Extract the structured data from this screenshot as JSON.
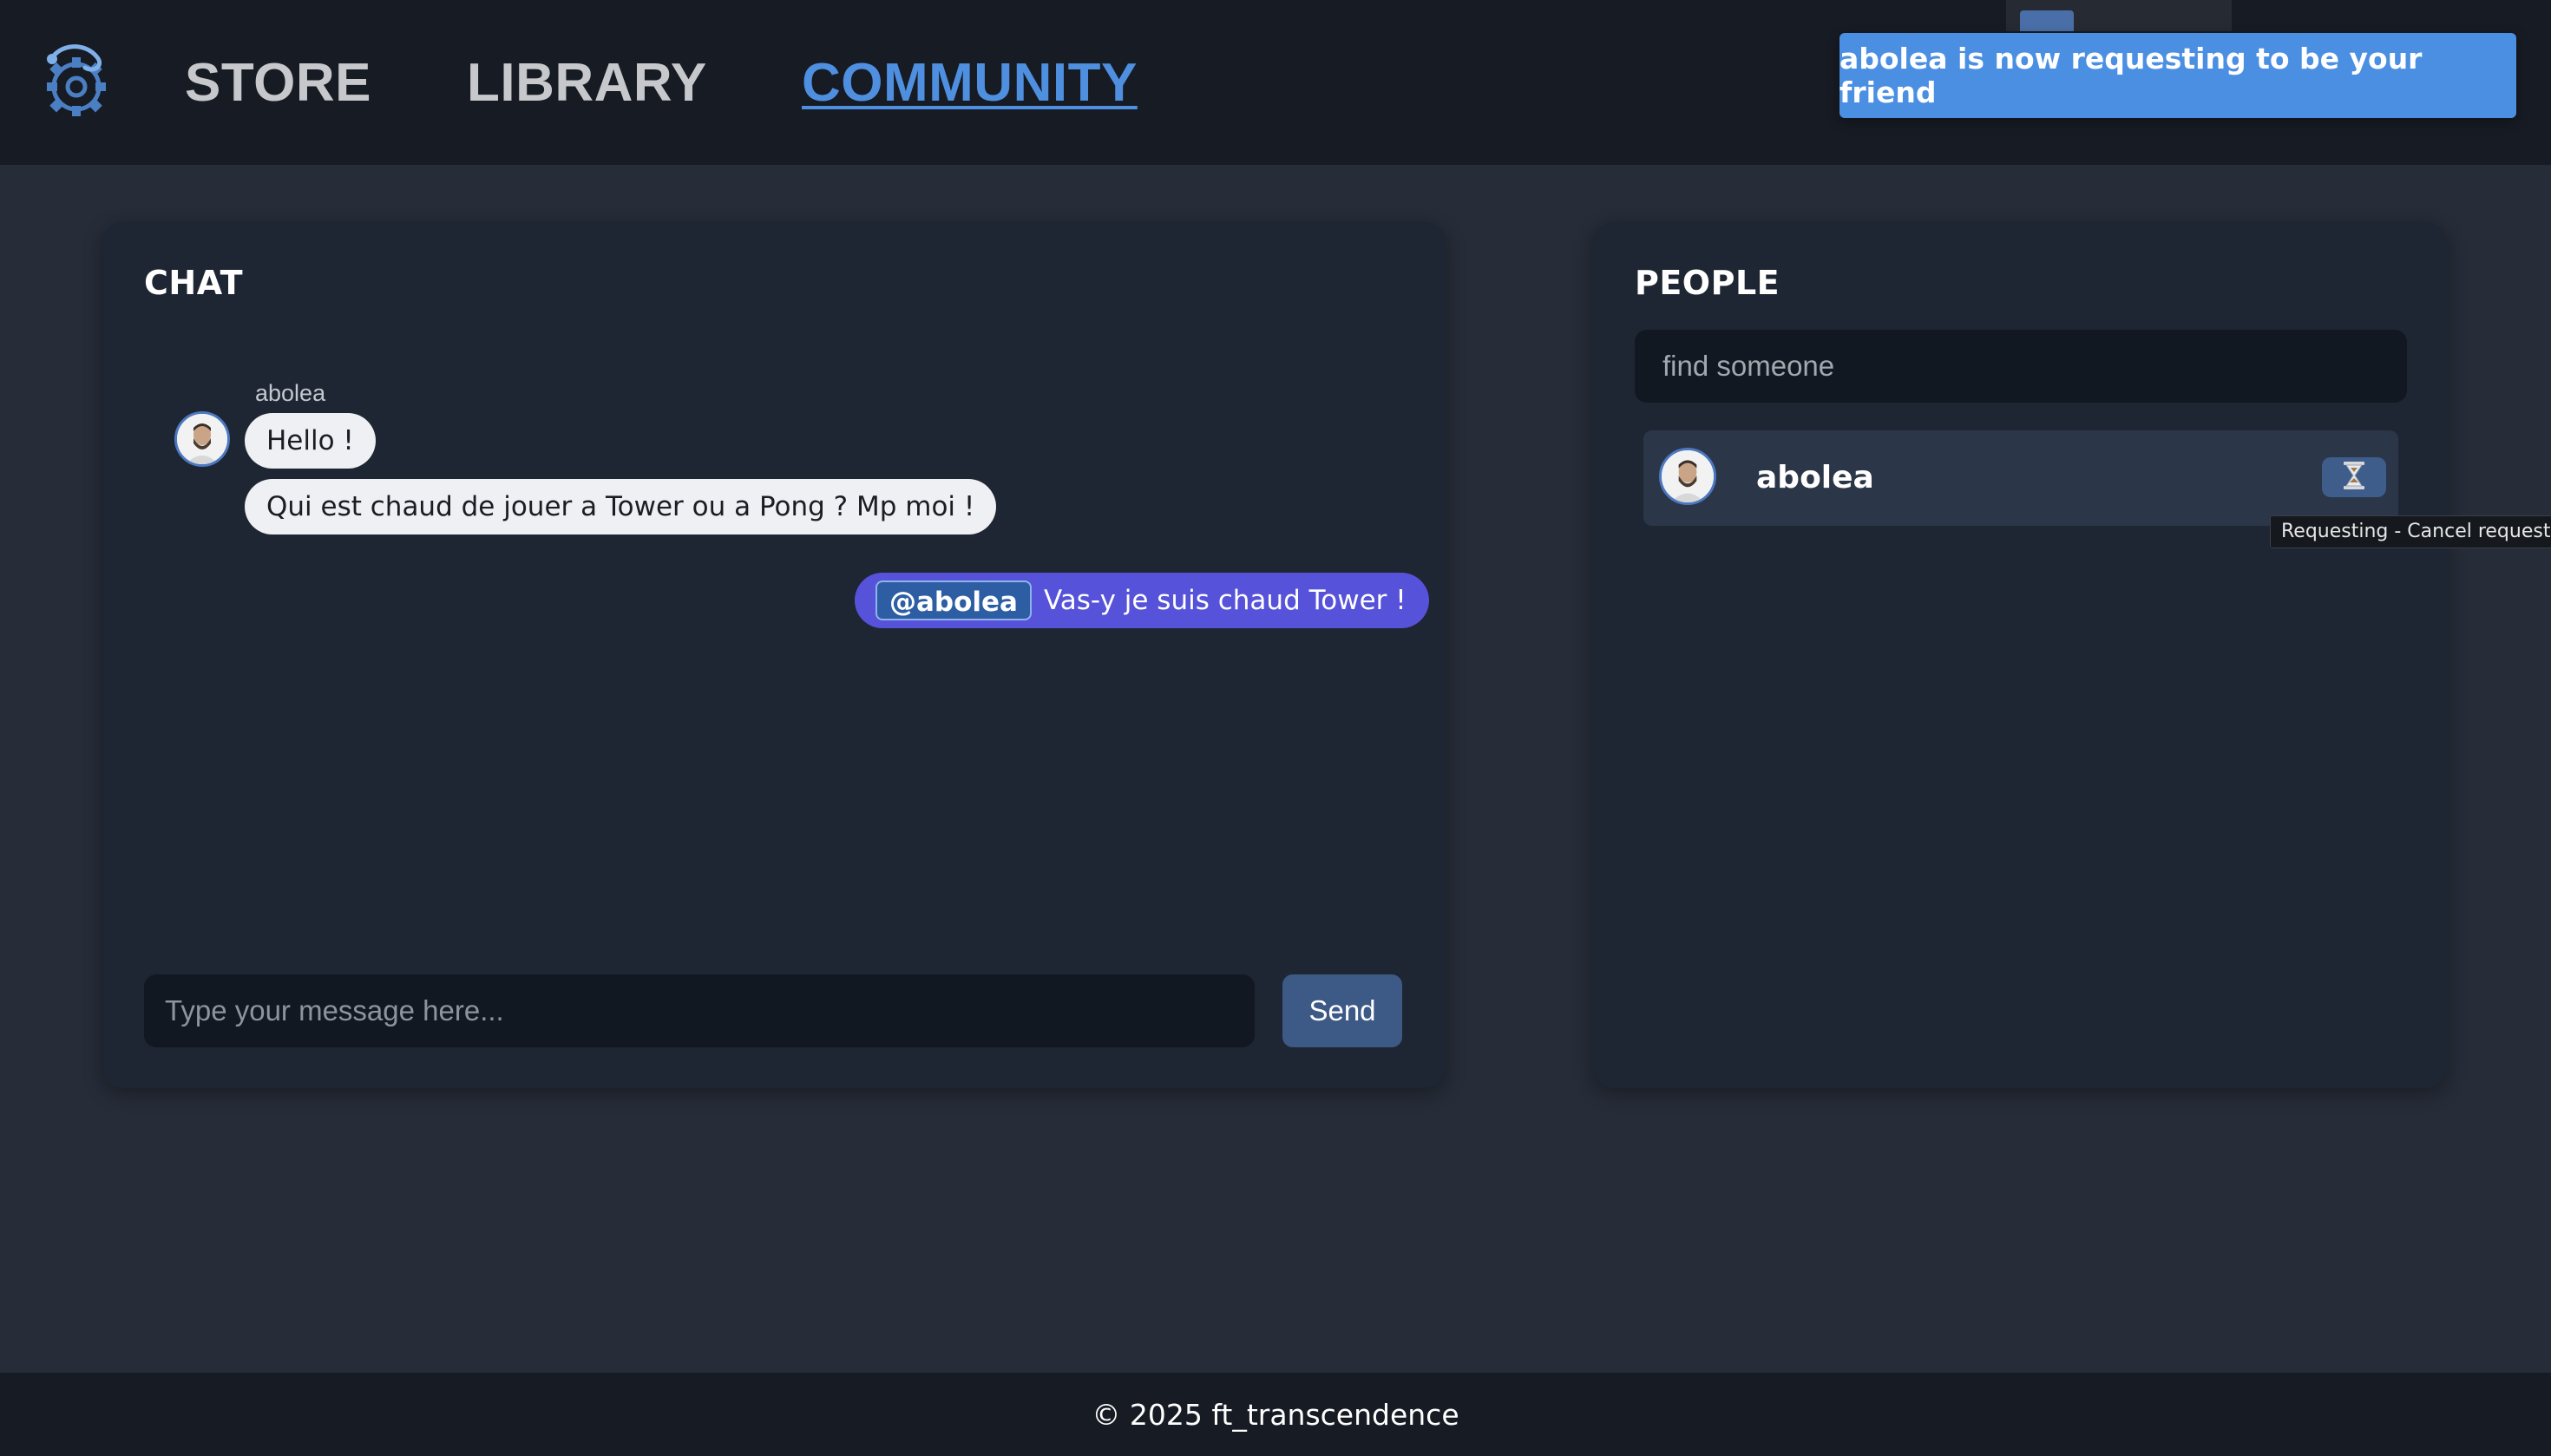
{
  "nav": {
    "items": [
      {
        "label": "STORE",
        "active": false
      },
      {
        "label": "LIBRARY",
        "active": false
      },
      {
        "label": "COMMUNITY",
        "active": true
      }
    ]
  },
  "notification": {
    "text": "abolea is now requesting to be your friend"
  },
  "chat": {
    "title": "CHAT",
    "messages": [
      {
        "author": "abolea",
        "texts": [
          "Hello !",
          "Qui est chaud de jouer a Tower ou a Pong ? Mp moi !"
        ]
      },
      {
        "mine": true,
        "mention": "@abolea",
        "text": "Vas-y je suis chaud Tower !"
      }
    ],
    "input_placeholder": "Type your message here...",
    "send_label": "Send"
  },
  "people": {
    "title": "PEOPLE",
    "search_placeholder": "find someone",
    "list": [
      {
        "name": "abolea",
        "status_icon": "hourglass-icon",
        "tooltip": "Requesting - Cancel request"
      }
    ]
  },
  "footer": {
    "text": "© 2025 ft_transcendence"
  },
  "colors": {
    "accent": "#4f8fe0",
    "toast": "#4b8fe2",
    "my_bubble": "#5652d9",
    "panel": "#1e2633",
    "background": "#262c38"
  }
}
